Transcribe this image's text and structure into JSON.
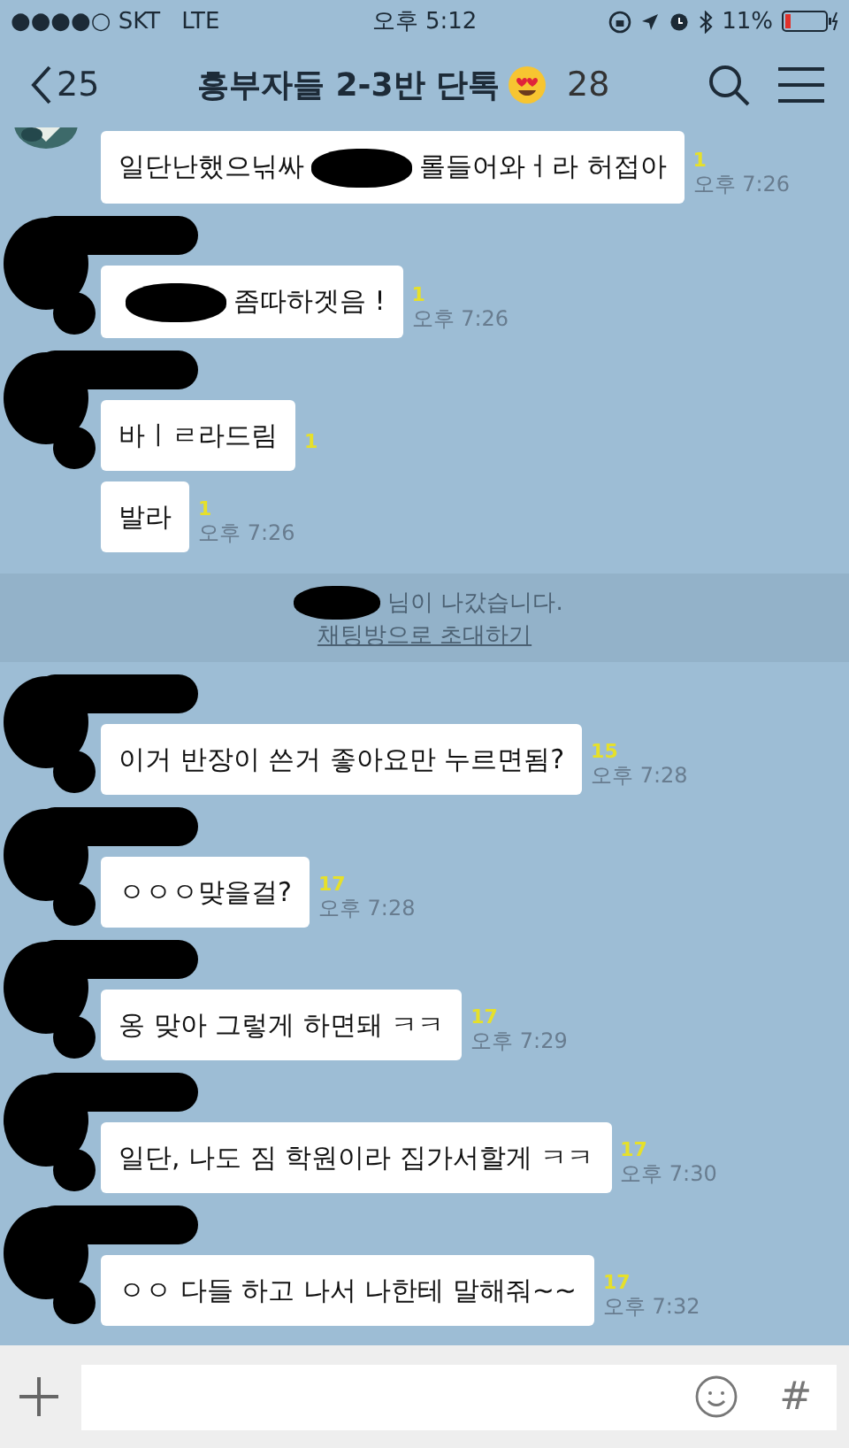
{
  "status_bar": {
    "carrier": "●●●●○ SKT",
    "network": "LTE",
    "time": "오후 5:12",
    "battery": "11%"
  },
  "header": {
    "back_count": "25",
    "title": "흥부자들 2-3반 단톡",
    "member_count": "28"
  },
  "messages": [
    {
      "kind": "message",
      "sender_redacted": false,
      "segments": [
        {
          "kind": "text",
          "text": "일단난했으닊싸"
        },
        {
          "kind": "redacted"
        },
        {
          "kind": "text",
          "text": "롤들어와ㅓ라 허접아"
        }
      ],
      "unread": "1",
      "time": "오후 7:26"
    },
    {
      "kind": "message",
      "sender_redacted": true,
      "segments": [
        {
          "kind": "redacted"
        },
        {
          "kind": "text",
          "text": "좀따하겟음 !"
        }
      ],
      "unread": "1",
      "time": "오후 7:26"
    },
    {
      "kind": "message",
      "sender_redacted": true,
      "segments": [
        {
          "kind": "text",
          "text": "바ㅣㄹ라드림"
        }
      ],
      "unread": "1"
    },
    {
      "kind": "message",
      "sender_redacted": false,
      "segments": [
        {
          "kind": "text",
          "text": "발라"
        }
      ],
      "unread": "1",
      "time": "오후 7:26"
    },
    {
      "kind": "notice",
      "segments": [
        {
          "kind": "redacted"
        },
        {
          "kind": "text",
          "text": "님이 나갔습니다."
        }
      ],
      "link": "채팅방으로 초대하기"
    },
    {
      "kind": "message",
      "sender_redacted": true,
      "segments": [
        {
          "kind": "text",
          "text": "이거 반장이 쓴거 좋아요만 누르면됨?"
        }
      ],
      "unread": "15",
      "time": "오후 7:28"
    },
    {
      "kind": "message",
      "sender_redacted": true,
      "segments": [
        {
          "kind": "text",
          "text": "ㅇㅇㅇ맞을걸?"
        }
      ],
      "unread": "17",
      "time": "오후 7:28"
    },
    {
      "kind": "message",
      "sender_redacted": true,
      "segments": [
        {
          "kind": "text",
          "text": "옹 맞아 그렇게 하면돼 ㅋㅋ"
        }
      ],
      "unread": "17",
      "time": "오후 7:29"
    },
    {
      "kind": "message",
      "sender_redacted": true,
      "segments": [
        {
          "kind": "text",
          "text": "일단, 나도 짐 학원이라 집가서할게 ㅋㅋ"
        }
      ],
      "unread": "17",
      "time": "오후 7:30"
    },
    {
      "kind": "message",
      "sender_redacted": true,
      "segments": [
        {
          "kind": "text",
          "text": "ㅇㅇ 다들 하고 나서 나한테 말해줘~~"
        }
      ],
      "unread": "17",
      "time": "오후 7:32"
    }
  ],
  "input_bar": {
    "hash": "#"
  }
}
